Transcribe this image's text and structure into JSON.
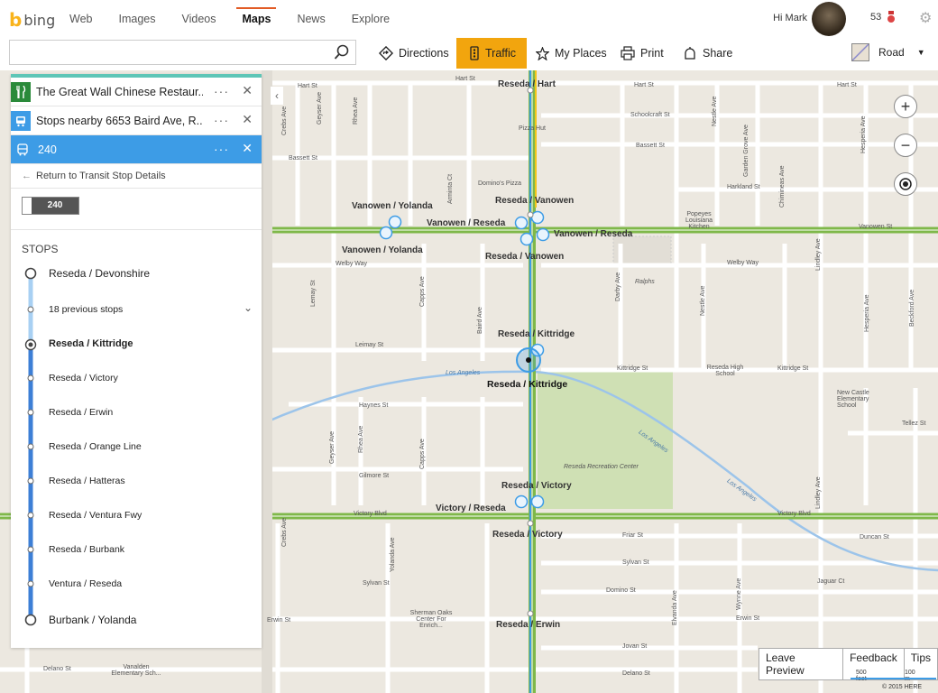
{
  "nav": {
    "logo": "bing",
    "links": [
      "Web",
      "Images",
      "Videos",
      "Maps",
      "News",
      "Explore"
    ],
    "active": "Maps",
    "greeting": "Hi Mark",
    "points": "53"
  },
  "toolbar": {
    "search_value": "",
    "directions": "Directions",
    "traffic": "Traffic",
    "my_places": "My Places",
    "print": "Print",
    "share": "Share",
    "map_style": "Road"
  },
  "panel": {
    "results": [
      {
        "title": "The Great Wall Chinese Restaur...",
        "icon": "fork-knife-icon"
      },
      {
        "title": "Stops nearby 6653 Baird Ave, R...",
        "icon": "transit-stop-icon"
      },
      {
        "title": "240",
        "icon": "bus-icon"
      }
    ],
    "return_link": "Return to Transit Stop Details",
    "route_badge": "240",
    "stops_header": "STOPS",
    "stops": [
      "Reseda / Devonshire",
      "18 previous stops",
      "Reseda / Kittridge",
      "Reseda / Victory",
      "Reseda / Erwin",
      "Reseda / Orange Line",
      "Reseda / Hatteras",
      "Reseda / Ventura Fwy",
      "Reseda / Burbank",
      "Ventura / Reseda",
      "Burbank / Yolanda"
    ]
  },
  "map": {
    "streets": {
      "hart1": "Hart St",
      "hart2": "Hart St",
      "hart3": "Hart St",
      "hart4": "Hart St",
      "schoolcraft": "Schoolcraft St",
      "bassett1": "Bassett St",
      "bassett2": "Bassett St",
      "harkland": "Harkland St",
      "vanowen": "Vanowen St",
      "welby1": "Welby Way",
      "welby2": "Welby Way",
      "leimay": "Leimay St",
      "kittridge1": "Kittridge St",
      "kittridge2": "Kittridge St",
      "haynes": "Haynes St",
      "gilmore": "Gilmore St",
      "victory1": "Victory Blvd",
      "victory2": "Victory Blvd",
      "friar": "Friar St",
      "sylvan1": "Sylvan St",
      "sylvan2": "Sylvan St",
      "domino": "Domino St",
      "jaguar": "Jaguar Ct",
      "duncan": "Duncan St",
      "erwin1": "Erwin St",
      "erwin2": "Erwin St",
      "jovan": "Jovan St",
      "delano1": "Delano St",
      "delano2": "Delano St",
      "tellez": "Tellez St",
      "crebs1": "Crebs Ave",
      "crebs2": "Crebs Ave",
      "geyser1": "Geyser Ave",
      "geyser2": "Geyser Ave",
      "rhea1": "Rhea Ave",
      "rhea2": "Rhea Ave",
      "arminta": "Arminta Ct",
      "capps1": "Capps Ave",
      "capps2": "Capps Ave",
      "baird": "Baird Ave",
      "darby": "Darby Ave",
      "yolanda": "Yolanda Ave",
      "nestle1": "Nestle Ave",
      "nestle2": "Nestle Ave",
      "garden": "Garden Grove Ave",
      "chimineas": "Chimineas Ave",
      "lindley1": "Lindley Ave",
      "lindley2": "Lindley Ave",
      "hesperia1": "Hesperia Ave",
      "hesperia2": "Hesperia Ave",
      "beckford": "Beckford Ave",
      "elvanda": "Elvanda Ave",
      "wynne": "Wynne Ave",
      "lemay": "Lemay St"
    },
    "pois": {
      "pizzahut": "Pizza Hut",
      "dominos": "Domino's Pizza",
      "popeyes": "Popeyes Louisiana Kitchen",
      "ralphs": "Ralphs",
      "reseda_high": "Reseda High School",
      "new_castle": "New Castle Elementary School",
      "rec_center": "Reseda Recreation Center",
      "sherman_oaks": "Sherman Oaks Center For Enrich...",
      "vanalden": "Vanalden Elementary Sch...",
      "la_river1": "Los Angeles",
      "la_river2": "Los Angeles",
      "la_river3": "Los Angeles"
    },
    "stops": {
      "hart": "Reseda / Hart",
      "vanowen_yolanda1": "Vanowen / Yolanda",
      "vanowen_yolanda2": "Vanowen / Yolanda",
      "reseda_vanowen1": "Reseda / Vanowen",
      "reseda_vanowen2": "Reseda / Vanowen",
      "vanowen_reseda1": "Vanowen / Reseda",
      "vanowen_reseda2": "Vanowen / Reseda",
      "kittridge1": "Reseda / Kittridge",
      "kittridge2": "Reseda / Kittridge",
      "victory1": "Reseda / Victory",
      "victory2": "Reseda / Victory",
      "victory_reseda": "Victory / Reseda",
      "erwin": "Reseda / Erwin"
    },
    "controls": {
      "leave_preview": "Leave Preview",
      "feedback": "Feedback",
      "tips": "Tips",
      "scale_feet": "500 feet",
      "scale_m": "100 m",
      "copyright": "© 2015 HERE"
    }
  }
}
